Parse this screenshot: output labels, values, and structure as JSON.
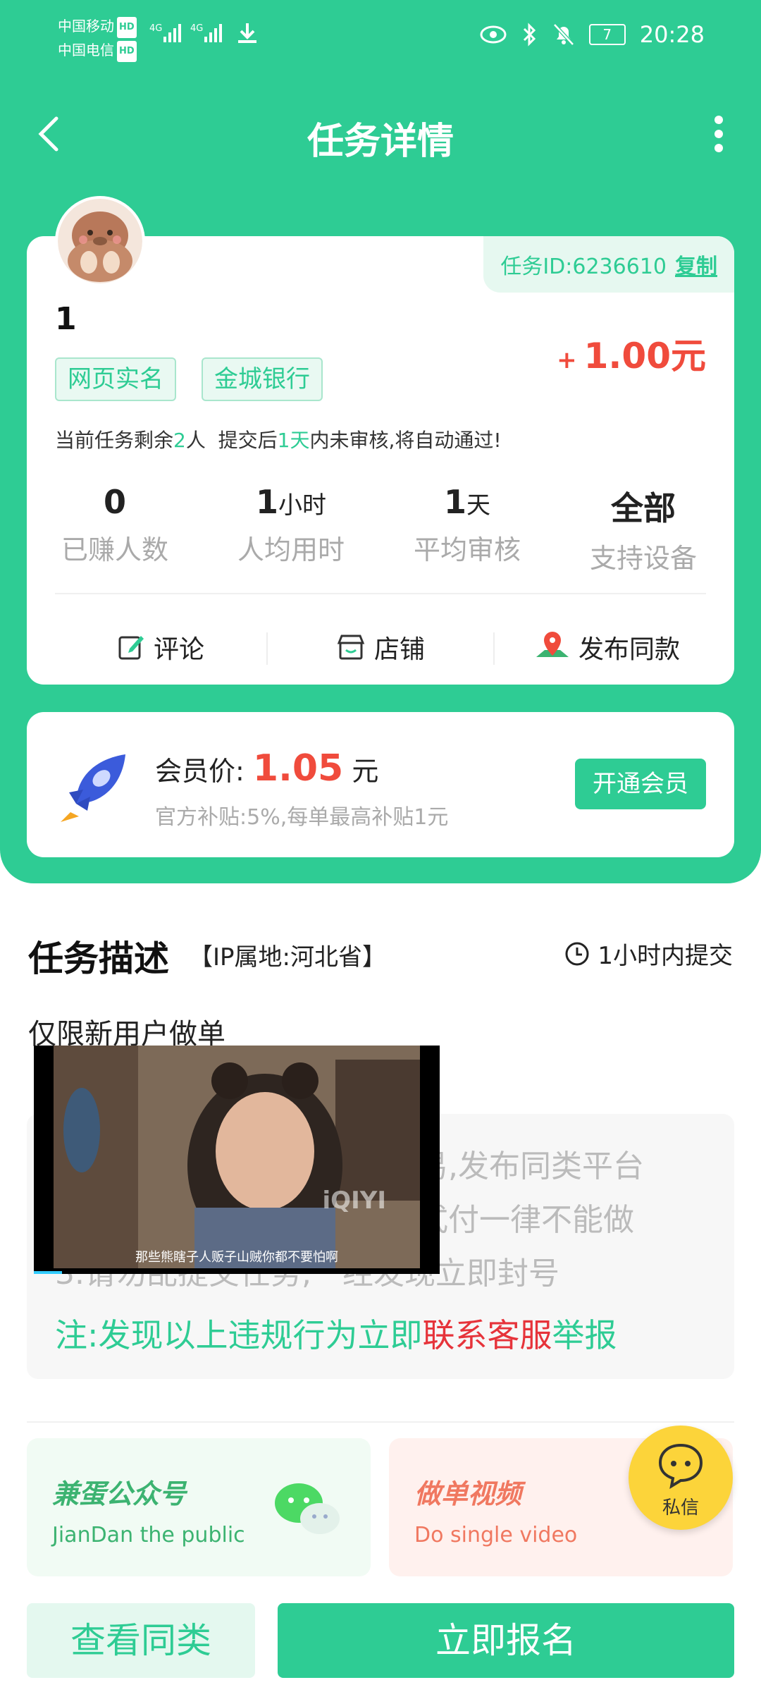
{
  "status_bar": {
    "carrier1": "中国移动",
    "carrier2": "中国电信",
    "hd": "HD",
    "network": "4G",
    "battery": "7",
    "time": "20:28"
  },
  "header": {
    "title": "任务详情"
  },
  "task": {
    "id_label": "任务ID:6236610",
    "copy_label": "复制",
    "name": "1",
    "tags": [
      "网页实名",
      "金城银行"
    ],
    "price_plus": "+",
    "price": "1.00元",
    "remain": {
      "prefix": "当前任务剩余",
      "count": "2",
      "mid": "人  提交后",
      "days": "1天",
      "suffix": "内未审核,将自动通过!"
    },
    "stats": [
      {
        "value": "0",
        "unit": "",
        "label": "已赚人数"
      },
      {
        "value": "1",
        "unit": "小时",
        "label": "人均用时"
      },
      {
        "value": "1",
        "unit": "天",
        "label": "平均审核"
      },
      {
        "value": "全部",
        "unit": "",
        "label": "支持设备"
      }
    ],
    "actions": {
      "comment": "评论",
      "store": "店铺",
      "publish": "发布同款"
    }
  },
  "vip": {
    "label": "会员价:",
    "amount": "1.05",
    "unit": "元",
    "subsidy": "官方补贴:5%,每单最高补贴1元",
    "button": "开通会员"
  },
  "description": {
    "title": "任务描述",
    "ip": "【IP属地:河北省】",
    "submit_time": "1小时内提交",
    "line1": "仅限新用户做单",
    "rule1": "易,发布同类平台",
    "rule2": "式付一律不能做",
    "rule3": "3.请勿乱提交任务,一经发现立即封号",
    "note_a": "注:发现以上违规行为立即",
    "note_b": "联系客服",
    "note_c": "举报"
  },
  "video": {
    "subtitle": "那些熊瞎子人贩子山贼你都不要怕啊",
    "logo": "iQIYI"
  },
  "promos": [
    {
      "title": "兼蛋公众号",
      "subtitle": "JianDan the public"
    },
    {
      "title": "做单视频",
      "subtitle": "Do single video"
    }
  ],
  "chat": {
    "label": "私信"
  },
  "bottom": {
    "similar": "查看同类",
    "signup": "立即报名"
  },
  "colors": {
    "primary": "#2ecc94",
    "price": "#f04b3c",
    "chat": "#fcd43a"
  }
}
